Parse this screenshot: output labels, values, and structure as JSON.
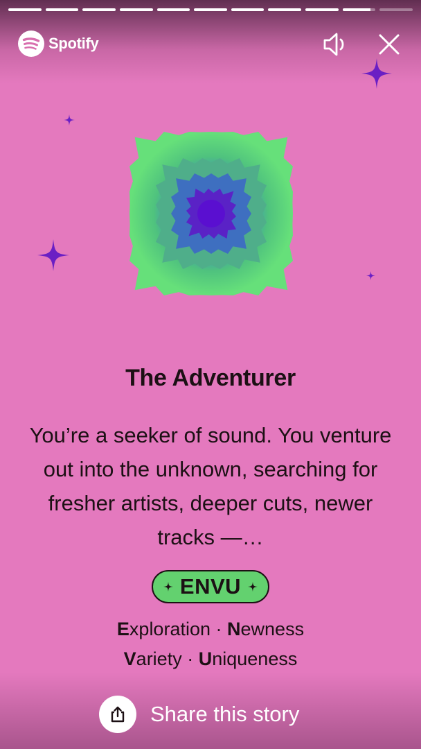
{
  "app": {
    "brand": "Spotify",
    "brand_icon": "spotify-logo-icon",
    "background_color": "#e479be",
    "accent_color": "#63d16f"
  },
  "story_progress": {
    "segments": [
      1,
      1,
      1,
      1,
      1,
      1,
      1,
      1,
      1,
      0.85,
      0
    ]
  },
  "controls": {
    "volume_icon": "speaker-muted-icon",
    "close_icon": "close-icon"
  },
  "story": {
    "title": "The Adventurer",
    "description": "You’re a seeker of sound. You venture out into the unknown, searching for fresher artists, deeper cuts, newer tracks —…",
    "badge": {
      "label": "ENVU",
      "icon": "sparkle-icon",
      "color": "#63d16f"
    },
    "traits": [
      {
        "initial": "E",
        "rest": "xploration"
      },
      {
        "initial": "N",
        "rest": "ewness"
      },
      {
        "initial": "V",
        "rest": "ariety"
      },
      {
        "initial": "U",
        "rest": "niqueness"
      }
    ],
    "separator": "·"
  },
  "share": {
    "label": "Share this story",
    "icon": "share-icon"
  }
}
